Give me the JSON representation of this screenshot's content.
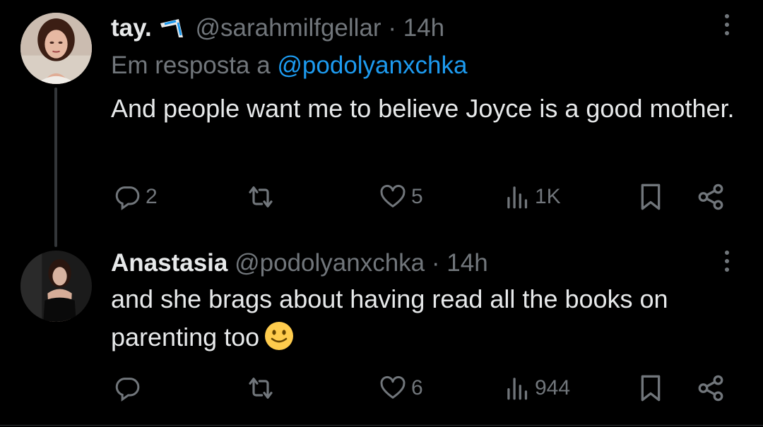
{
  "colors": {
    "background": "#000000",
    "text_primary": "#e7e9ea",
    "text_secondary": "#71767b",
    "link": "#1d9bf0",
    "thread_line": "#333639"
  },
  "tweets": [
    {
      "display_name": "tay.",
      "badge_icon": "boomerang-icon",
      "handle": "@sarahmilfgellar",
      "separator": "·",
      "time": "14h",
      "reply_prefix": "Em resposta a",
      "reply_handle": "@podolyanxchka",
      "text": "And people want me to believe Joyce is a good mother.",
      "emoji": "",
      "actions": {
        "replies": "2",
        "retweets": "",
        "likes": "5",
        "views": "1K"
      }
    },
    {
      "display_name": "Anastasia",
      "handle": "@podolyanxchka",
      "separator": "·",
      "time": "14h",
      "text": "and she brags about having read all the books on parenting too",
      "emoji": "slightly-smiling-face-icon",
      "actions": {
        "replies": "",
        "retweets": "",
        "likes": "6",
        "views": "944"
      }
    }
  ],
  "icons": {
    "reply": "reply-icon",
    "retweet": "retweet-icon",
    "like": "heart-icon",
    "views": "views-icon",
    "bookmark": "bookmark-icon",
    "share": "share-icon",
    "more": "more-options-icon"
  }
}
